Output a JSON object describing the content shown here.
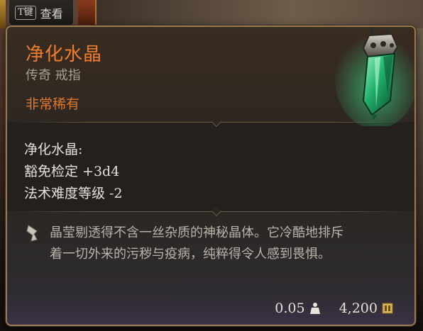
{
  "hotkey": {
    "key": "T键",
    "label": "查看"
  },
  "item": {
    "name": "净化水晶",
    "type": "传奇 戒指",
    "rarity": "非常稀有"
  },
  "stats": {
    "header": "净化水晶:",
    "lines": [
      "豁免检定 +3d4",
      "法术难度等级 -2"
    ]
  },
  "description": {
    "line1": "晶莹剔透得不含一丝杂质的神秘晶体。它冷酷地排斥",
    "line2": "着一切外来的污秽与疫病，纯粹得令人感到畏惧。"
  },
  "footer": {
    "weight": "0.05",
    "price": "4,200",
    "weight_icon": "weight-icon",
    "price_icon": "gold-coin-icon"
  },
  "colors": {
    "item_name": "#ef7d2c",
    "rarity": "#e0782a",
    "border": "#9a7a52",
    "crystal_glow": "#35e08a"
  }
}
